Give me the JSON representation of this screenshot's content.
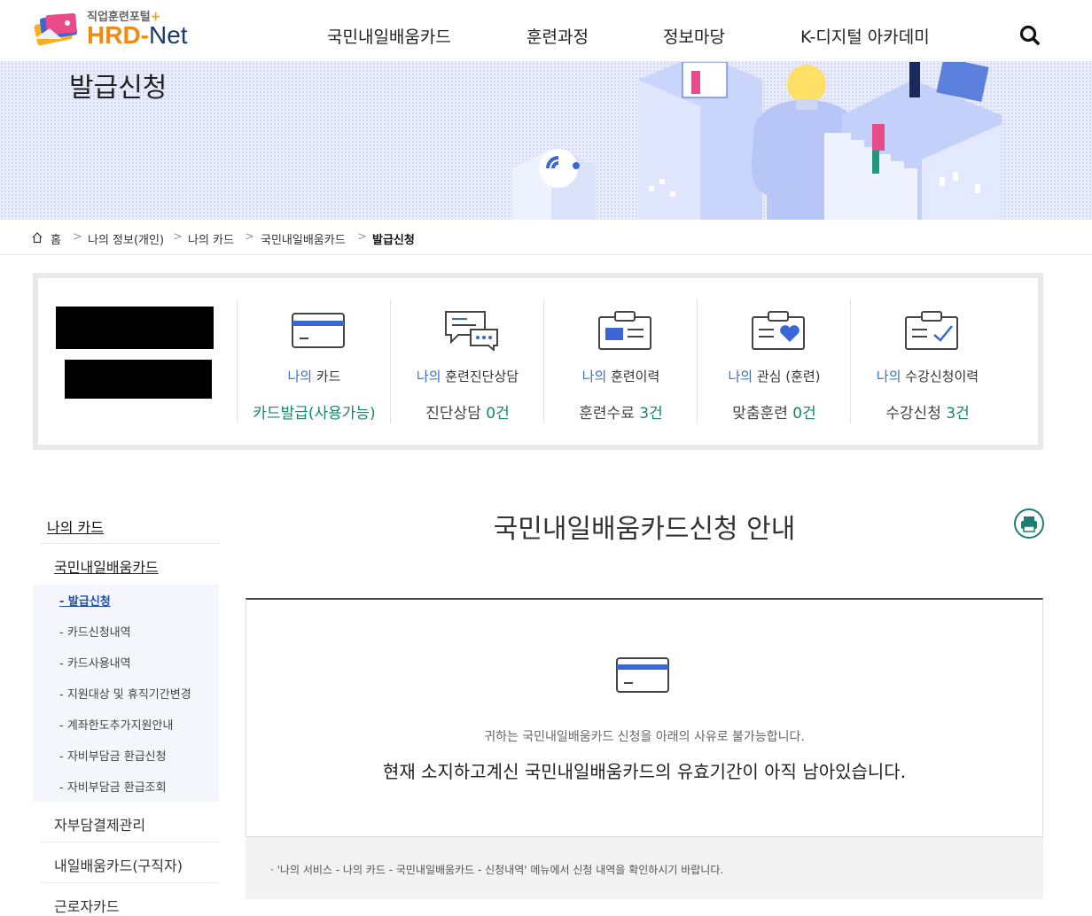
{
  "header": {
    "logo_sub": "직업훈련포털",
    "logo_plus": "+",
    "logo_hrd": "HRD-",
    "logo_net": "Net",
    "nav": [
      "국민내일배움카드",
      "훈련과정",
      "정보마당",
      "K-디지털 아카데미"
    ]
  },
  "banner": {
    "title": "발급신청"
  },
  "breadcrumb": [
    "홈",
    "나의 정보(개인)",
    "나의 카드",
    "국민내일배움카드",
    "발급신청"
  ],
  "summary": {
    "columns": [
      {
        "mine": "나의",
        "label": " 카드",
        "value_text": "카드발급(사용가능)",
        "value_count": ""
      },
      {
        "mine": "나의",
        "label": " 훈련진단상담",
        "value_text": "진단상담 ",
        "value_count": "0건"
      },
      {
        "mine": "나의",
        "label": " 훈련이력",
        "value_text": "훈련수료 ",
        "value_count": "3건"
      },
      {
        "mine": "나의",
        "label": " 관심 (훈련)",
        "value_text": "맞춤훈련 ",
        "value_count": "0건"
      },
      {
        "mine": "나의",
        "label": " 수강신청이력",
        "value_text": "수강신청 ",
        "value_count": "3건"
      }
    ]
  },
  "sidebar": {
    "title": "나의 카드",
    "section": "국민내일배움카드",
    "leaves": [
      "- 발급신청",
      "- 카드신청내역",
      "- 카드사용내역",
      "- 지원대상 및 휴직기간변경",
      "- 계좌한도추가지원안내",
      "- 자비부담금 환급신청",
      "- 자비부담금 환급조회"
    ],
    "others": [
      "자부담결제관리",
      "내일배움카드(구직자)",
      "근로자카드"
    ]
  },
  "main": {
    "title": "국민내일배움카드신청 안내",
    "notice_sub": "귀하는 국민내일배움카드 신청을 아래의 사유로 불가능합니다.",
    "notice_main": "현재 소지하고계신 국민내일배움카드의 유효기간이 아직 남아있습니다.",
    "footnote": "·  '나의 서비스 - 나의 카드 - 국민내일배움카드 - 신청내역' 메뉴에서 신청 내역을 확인하시기 바랍니다."
  },
  "colors": {
    "accent_green": "#17856a",
    "accent_blue": "#3a6fd0",
    "card_blue": "#3a66d6"
  }
}
